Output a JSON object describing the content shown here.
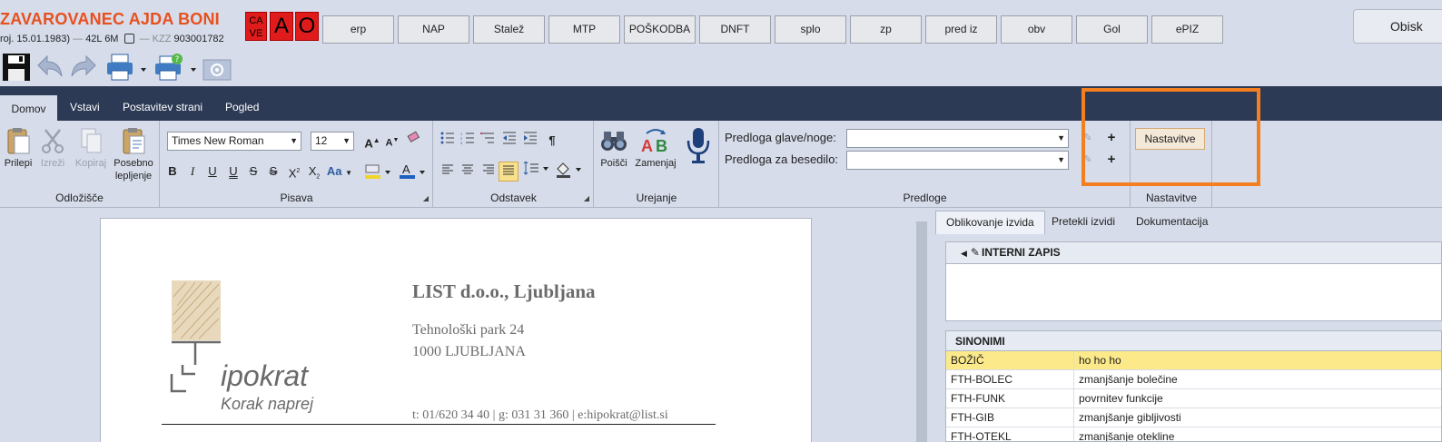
{
  "patient": {
    "name": "ZAVAROVANEC AJDA BONI",
    "dob": "roj. 15.01.1983)",
    "sep1": "—",
    "age": "42L 6M",
    "kzz_label": "— KZZ",
    "kzz": "903001782"
  },
  "flags": {
    "cave_top": "CA",
    "cave_bottom": "VE",
    "a": "A",
    "o": "O"
  },
  "top_buttons": [
    "erp",
    "NAP",
    "Stalež",
    "MTP",
    "POŠKODBA",
    "DNFT",
    "splo",
    "zp",
    "pred iz",
    "obv",
    "Gol",
    "ePIZ"
  ],
  "obisk": "Obisk",
  "ribbon_tabs": [
    "Domov",
    "Vstavi",
    "Postavitev strani",
    "Pogled"
  ],
  "clipboard": {
    "paste": "Prilepi",
    "cut": "Izreži",
    "copy": "Kopiraj",
    "paste_special_1": "Posebno",
    "paste_special_2": "lepljenje",
    "label": "Odložišče"
  },
  "font": {
    "family": "Times New Roman",
    "size": "12",
    "label": "Pisava",
    "aa": "Aa"
  },
  "paragraph": {
    "label": "Odstavek"
  },
  "editing": {
    "find": "Poišči",
    "replace": "Zamenjaj",
    "label": "Urejanje"
  },
  "templates": {
    "header_label": "Predloga glave/noge:",
    "body_label": "Predloga za besedilo:",
    "header_value": "",
    "body_value": "",
    "label": "Predloge"
  },
  "settings": {
    "button": "Nastavitve",
    "label": "Nastavitve"
  },
  "document": {
    "company": "LIST d.o.o., Ljubljana",
    "address1": "Tehnološki park 24",
    "address2": "1000 LJUBLJANA",
    "contact": "t: 01/620 34 40 | g: 031 31 360 | e:hipokrat@list.si",
    "logo_brand": "ipokrat",
    "logo_tagline": "Korak naprej"
  },
  "right_tabs": [
    "Oblikovanje izvida",
    "Pretekli izvidi",
    "Dokumentacija"
  ],
  "intern_title": "INTERNI ZAPIS",
  "synonyms": {
    "title": "SINONIMI",
    "rows": [
      {
        "key": "BOŽIČ",
        "value": "ho ho ho"
      },
      {
        "key": "FTH-BOLEC",
        "value": "zmanjšanje bolečine"
      },
      {
        "key": "FTH-FUNK",
        "value": "povrnitev funkcije"
      },
      {
        "key": "FTH-GIB",
        "value": "zmanjšanje gibljivosti"
      },
      {
        "key": "FTH-OTEKL",
        "value": "zmanjšanje otekline"
      }
    ]
  },
  "colors": {
    "accent": "#e8501e",
    "ribbon_bar": "#2c3a55",
    "highlight": "#f47f20",
    "row_highlight": "#fce98a"
  }
}
